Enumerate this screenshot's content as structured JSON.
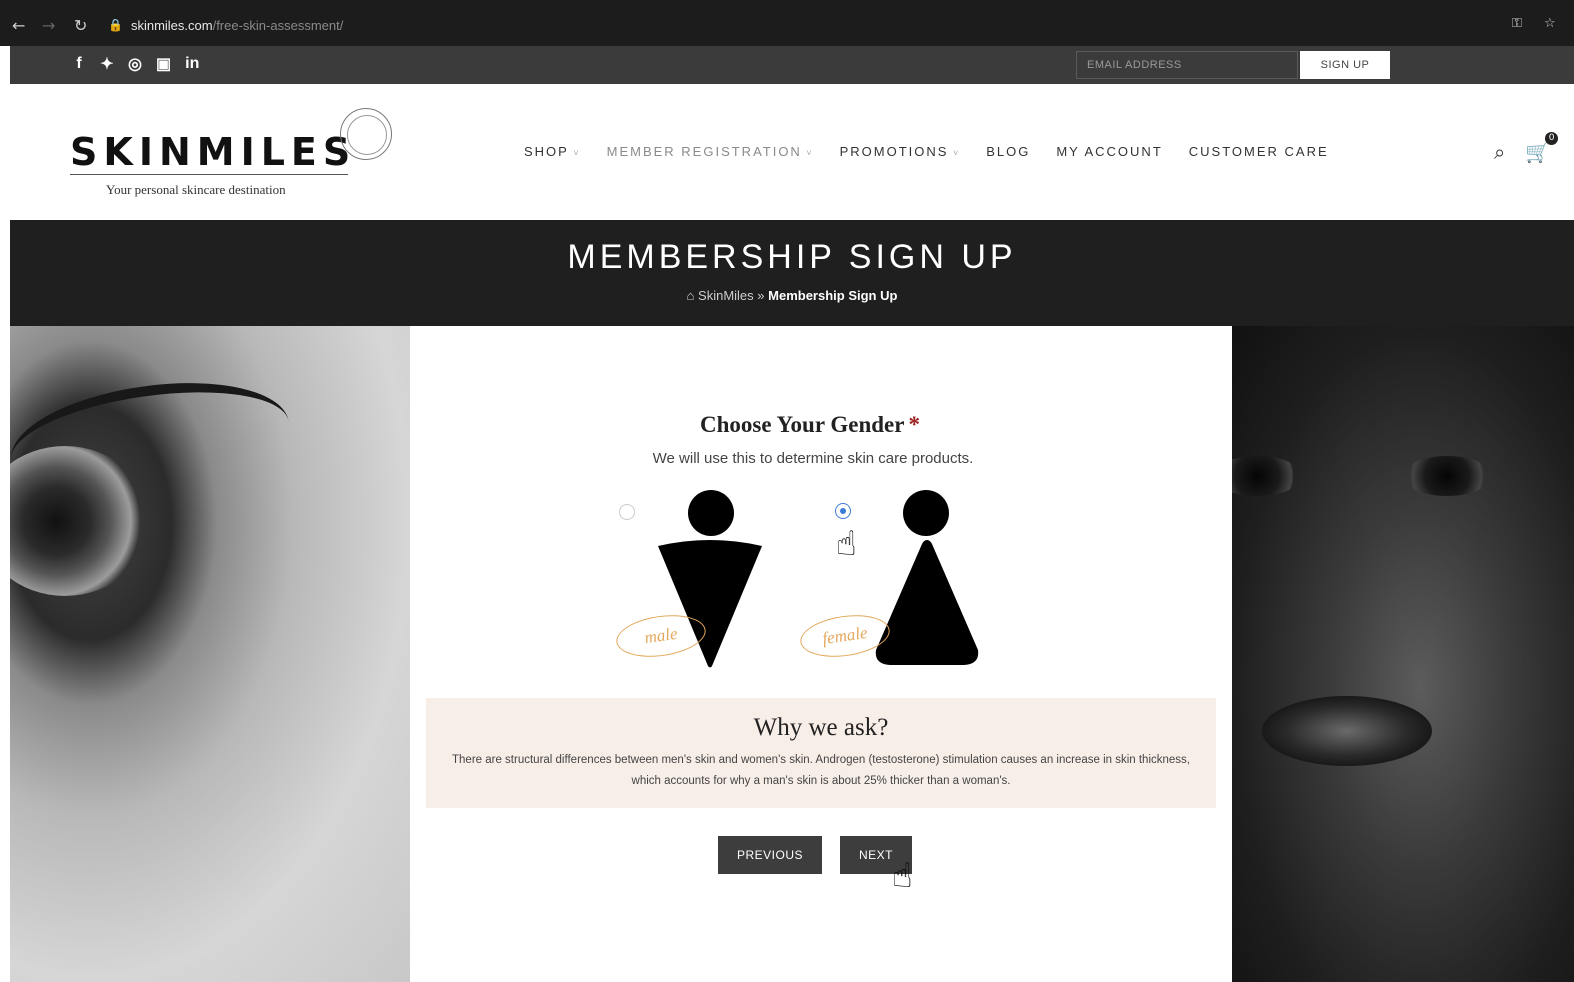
{
  "browser": {
    "url_host": "skinmiles.com",
    "url_path": "/free-skin-assessment/",
    "key_icon": "key-icon",
    "star_icon": "star-icon"
  },
  "top_strip": {
    "social_icons": [
      "facebook-icon",
      "twitter-icon",
      "instagram-icon",
      "youtube-icon",
      "linkedin-icon"
    ],
    "newsletter_placeholder": "EMAIL ADDRESS",
    "signup_label": "SIGN UP"
  },
  "header": {
    "logo_text": "SKINMILES",
    "tagline": "Your personal skincare destination",
    "nav": [
      {
        "label": "SHOP"
      },
      {
        "label": "MEMBER REGISTRATION"
      },
      {
        "label": "PROMOTIONS"
      },
      {
        "label": "BLOG"
      },
      {
        "label": "MY ACCOUNT"
      },
      {
        "label": "CUSTOMER CARE"
      }
    ],
    "cart_count": "0"
  },
  "title_band": {
    "title": "MEMBERSHIP SIGN UP",
    "breadcrumb_home": "SkinMiles",
    "breadcrumb_sep": "»",
    "breadcrumb_current": "Membership Sign Up"
  },
  "question": {
    "title": "Choose Your Gender",
    "required_mark": "*",
    "subtitle": "We will use this to determine skin care products.",
    "options": [
      {
        "label": "male",
        "selected": false
      },
      {
        "label": "female",
        "selected": true
      }
    ]
  },
  "why": {
    "title": "Why we ask?",
    "text": "There are structural differences between men's skin and women's skin. Androgen (testosterone) stimulation causes an increase in skin thickness, which accounts for why a man's skin is about 25% thicker than a woman's."
  },
  "buttons": {
    "previous": "PREVIOUS",
    "next": "NEXT"
  },
  "colors": {
    "dark_band": "#1f1f1f",
    "top_strip": "#3b3b3b",
    "why_bg": "#f8eee8",
    "accent_label": "#e4a85c",
    "radio_selected": "#3a7bd5",
    "button_bg": "#3d3d3d"
  }
}
